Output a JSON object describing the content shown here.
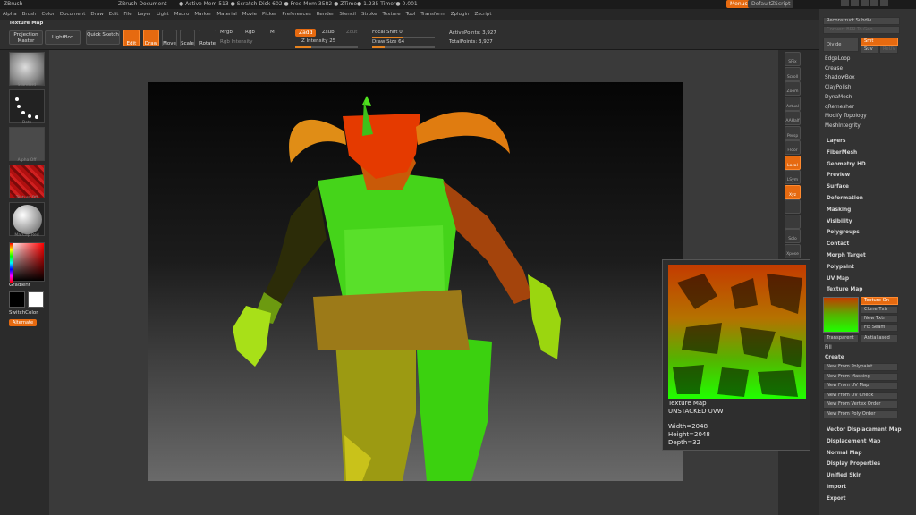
{
  "title_bar": {
    "app": "ZBrush",
    "document": "ZBrush Document",
    "stats": "● Active Mem 513 ● Scratch Disk 602 ● Free Mem 3582 ● ZTime● 1.235 Timer● 0.001",
    "menus_button": "Menus",
    "script_button": "DefaultZScript"
  },
  "menu_bar": [
    "Alpha",
    "Brush",
    "Color",
    "Document",
    "Draw",
    "Edit",
    "File",
    "Layer",
    "Light",
    "Macro",
    "Marker",
    "Material",
    "Movie",
    "Picker",
    "Preferences",
    "Render",
    "Stencil",
    "Stroke",
    "Texture",
    "Tool",
    "Transform",
    "Zplugin",
    "Zscript"
  ],
  "toolbar": {
    "palette_label": "Texture Map",
    "projection_master": "Projection Master",
    "lightbox": "LightBox",
    "quick_sketch": "Quick Sketch",
    "edit": "Edit",
    "draw": "Draw",
    "move": "Move",
    "scale": "Scale",
    "rotate": "Rotate",
    "mrgb": "Mrgb",
    "rgb": "Rgb",
    "m": "M",
    "rgb_intensity": "Rgb Intensity",
    "zadd": "Zadd",
    "zsub": "Zsub",
    "zcut": "Zcut",
    "z_intensity_label": "Z Intensity",
    "z_intensity": "25",
    "focal_shift_label": "Focal Shift",
    "focal_shift": "0",
    "draw_size_label": "Draw Size",
    "draw_size": "64",
    "active_points": "ActivePoints: 3,927",
    "total_points": "TotalPoints: 3,927"
  },
  "left_shelf": {
    "brush_label": "Standard",
    "stroke_label": "Dots",
    "alpha_label": "Alpha Off",
    "texture_label": "Texture Off",
    "material_label": "MatCap Red",
    "gradient": "Gradient",
    "switch_color": "SwitchColor",
    "alternate": "Alternate"
  },
  "right_shelf": [
    "SPix",
    "Scroll",
    "Zoom",
    "Actual",
    "AAHalf",
    "Persp",
    "Floor",
    "Local",
    "LSym",
    "Xyz",
    "",
    "",
    "Solo",
    "Xpose"
  ],
  "tray": {
    "top_items": [
      "Reconstruct Subdiv",
      "Convert BPR To Geo",
      "Divide",
      "Smt",
      "Suv",
      "ReUV",
      "EdgeLoop",
      "Crease",
      "ShadowBox",
      "ClayPolish",
      "DynaMesh",
      "qRemesher",
      "Modify Topology",
      "MeshIntegrity"
    ],
    "sections": [
      "Layers",
      "FiberMesh",
      "Geometry HD",
      "Preview",
      "Surface",
      "Deformation",
      "Masking",
      "Visibility",
      "Polygroups",
      "Contact",
      "Morph Target",
      "Polypaint",
      "UV Map",
      "Texture Map"
    ],
    "texture_buttons": [
      "Texture On",
      "Clone Txtr",
      "New Txtr",
      "Fix Seam"
    ],
    "transparent": "Transparent",
    "antialiased": "Antialiased",
    "fill": "Fill",
    "create": "Create",
    "create_items": [
      "New From Polypaint",
      "New From Masking",
      "New From UV Map",
      "New From UV Check",
      "New From Vertex Order",
      "New From Poly Order"
    ],
    "bottom_items": [
      "Vector Displacement Map",
      "Displacement Map",
      "Normal Map",
      "Display Properties",
      "Unified Skin",
      "Import",
      "Export"
    ]
  },
  "popup": {
    "title": "Texture Map",
    "subtitle": "UNSTACKED UVW",
    "width": "Width=2048",
    "height": "Height=2048",
    "depth": "Depth=32"
  },
  "colors": {
    "accent": "#e66a10",
    "panel": "#333333",
    "canvas_bg": "#050505"
  }
}
